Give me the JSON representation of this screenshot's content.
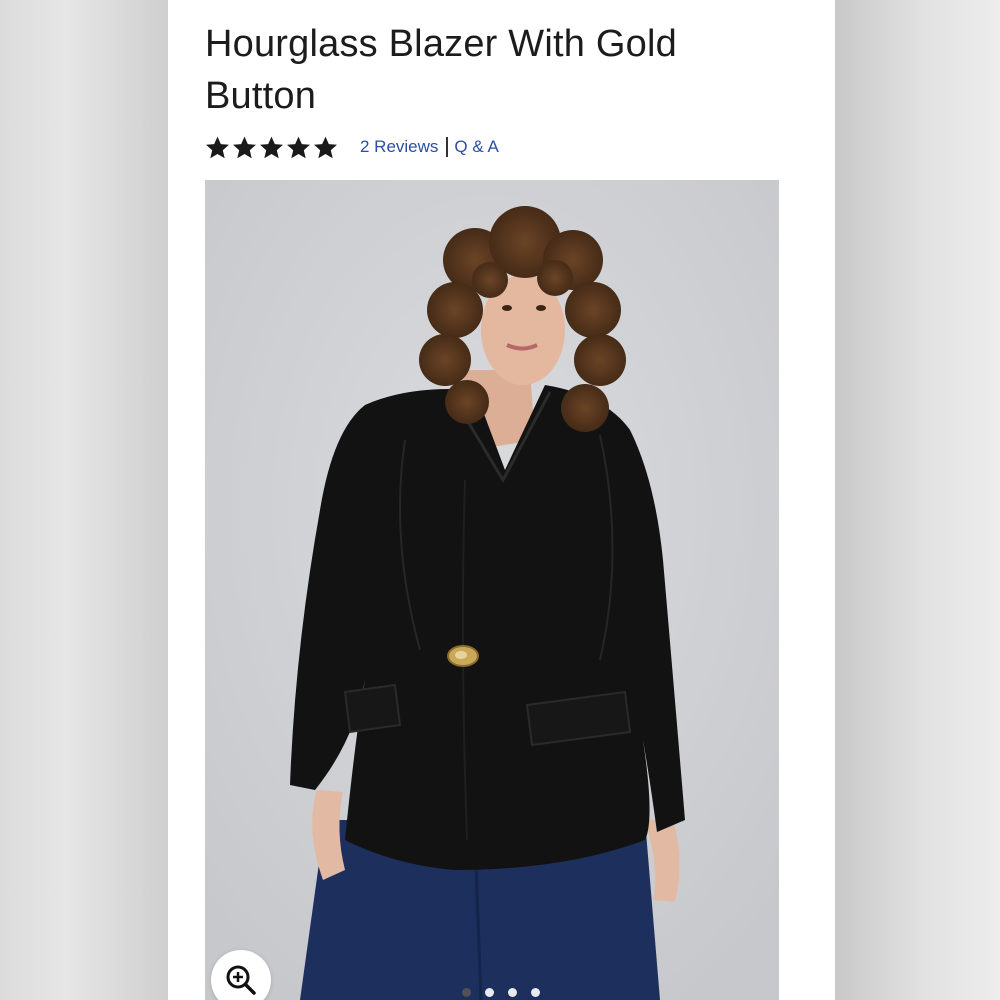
{
  "product": {
    "title": "Hourglass Blazer With Gold Button",
    "rating": 5,
    "max_rating": 5,
    "reviews_label": "2 Reviews",
    "qa_label": "Q & A"
  },
  "gallery": {
    "image_count": 4,
    "active_index": 0,
    "zoom_icon": "zoom-in-icon"
  },
  "colors": {
    "link": "#2b4fa1",
    "star": "#1a1a1a",
    "photo_bg": "#d1d2d6"
  }
}
